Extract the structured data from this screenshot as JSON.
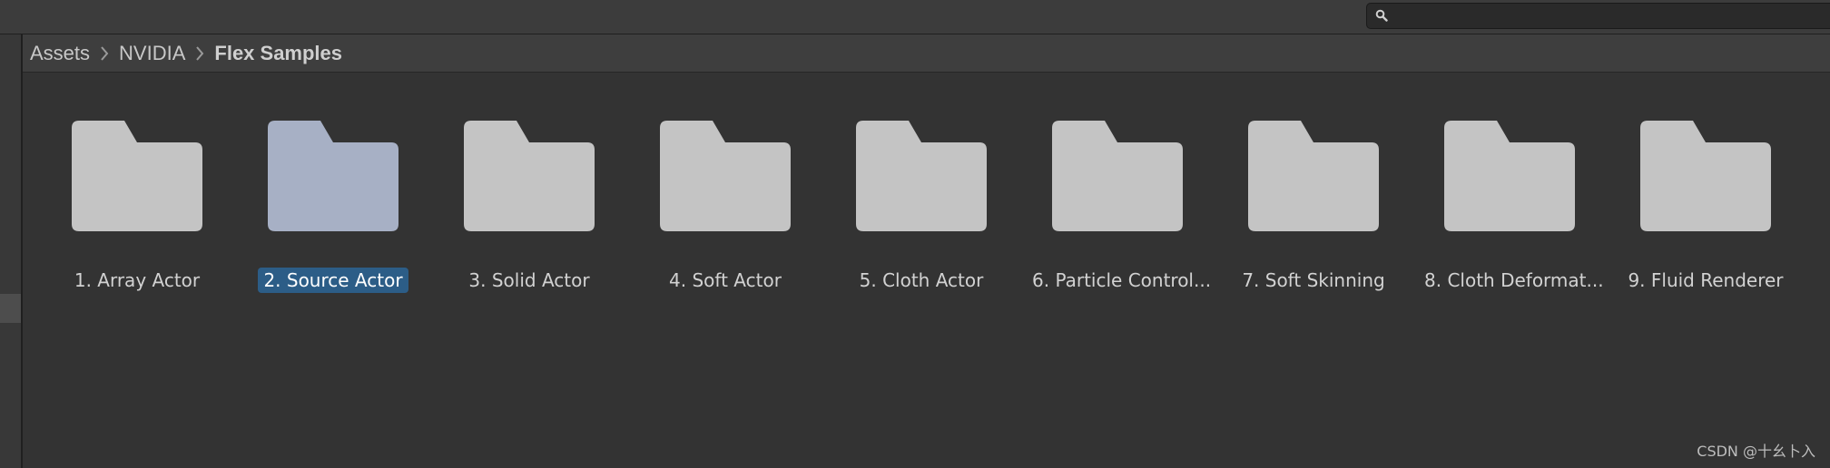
{
  "search": {
    "value": "",
    "placeholder": ""
  },
  "breadcrumb": {
    "items": [
      "Assets",
      "NVIDIA",
      "Flex Samples"
    ]
  },
  "folders": [
    {
      "label": "1. Array Actor",
      "selected": false
    },
    {
      "label": "2. Source Actor",
      "selected": true
    },
    {
      "label": "3. Solid Actor",
      "selected": false
    },
    {
      "label": "4. Soft Actor",
      "selected": false
    },
    {
      "label": "5. Cloth Actor",
      "selected": false
    },
    {
      "label": "6. Particle Control...",
      "selected": false
    },
    {
      "label": "7. Soft Skinning",
      "selected": false
    },
    {
      "label": "8. Cloth Deformat...",
      "selected": false
    },
    {
      "label": "9. Fluid Renderer",
      "selected": false
    }
  ],
  "colors": {
    "folder": "#c4c4c4",
    "folder_selected": "#a7b0c5",
    "selection": "#2c5d87"
  },
  "watermark": "CSDN @十幺卜入"
}
